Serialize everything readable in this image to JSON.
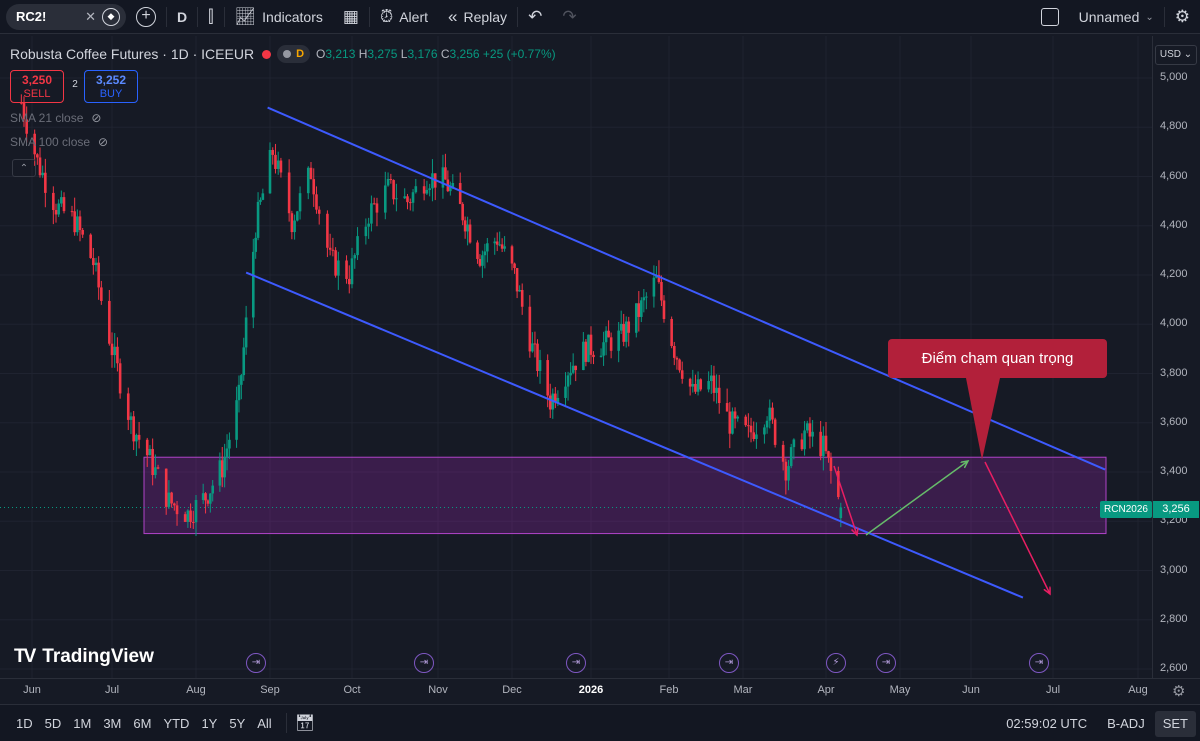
{
  "toolbar": {
    "symbol": "RC2!",
    "interval": "D",
    "indicators_label": "Indicators",
    "alert_label": "Alert",
    "replay_label": "Replay",
    "layout_name": "Unnamed"
  },
  "legend": {
    "title": "Robusta Coffee Futures · 1D · ICEEUR",
    "pill_interval": "D",
    "ohlc": {
      "open": "3,213",
      "high": "3,275",
      "low": "3,176",
      "close": "3,256",
      "change": "+25 (+0.77%)"
    },
    "sell_price": "3,250",
    "sell_label": "SELL",
    "buy_price": "3,252",
    "buy_label": "BUY",
    "spread": "2",
    "indicators": [
      "SMA 21 close",
      "SMA 100 close"
    ]
  },
  "price_axis": {
    "currency": "USD",
    "ticks": [
      "5,000",
      "4,800",
      "4,600",
      "4,400",
      "4,200",
      "4,000",
      "3,800",
      "3,600",
      "3,400",
      "3,200",
      "3,000",
      "2,800",
      "2,600"
    ],
    "last_price": "3,256",
    "contract_label": "RCN2026"
  },
  "time_axis": {
    "ticks": [
      "Jun",
      "Jul",
      "Aug",
      "Sep",
      "Oct",
      "Nov",
      "Dec",
      "2026",
      "Feb",
      "Mar",
      "Apr",
      "May",
      "Jun",
      "Jul",
      "Aug"
    ]
  },
  "annotation": {
    "callout_text": "Điểm chạm quan trọng"
  },
  "watermark": "TradingView",
  "bottom": {
    "ranges": [
      "1D",
      "5D",
      "1M",
      "3M",
      "6M",
      "YTD",
      "1Y",
      "5Y",
      "All"
    ],
    "clock": "02:59:02 UTC",
    "adj": "B-ADJ",
    "set": "SET"
  },
  "colors": {
    "up": "#089981",
    "down": "#f23645",
    "channel": "#2962ff",
    "zone": "#9c27b0",
    "callout": "#b2203a"
  },
  "chart_data": {
    "type": "candlestick",
    "title": "Robusta Coffee Futures · 1D · ICEEUR",
    "ylim": [
      2600,
      5000
    ],
    "x_labels": [
      "Jun",
      "Jul",
      "Aug",
      "Sep",
      "Oct",
      "Nov",
      "Dec",
      "2026",
      "Feb",
      "Mar",
      "Apr",
      "May",
      "Jun",
      "Jul",
      "Aug"
    ],
    "close_path": [
      [
        "2025-05-28",
        4900
      ],
      [
        "2025-06-03",
        4660
      ],
      [
        "2025-06-10",
        4480
      ],
      [
        "2025-06-17",
        4420
      ],
      [
        "2025-06-24",
        4250
      ],
      [
        "2025-07-01",
        3900
      ],
      [
        "2025-07-08",
        3600
      ],
      [
        "2025-07-15",
        3450
      ],
      [
        "2025-07-22",
        3280
      ],
      [
        "2025-07-29",
        3230
      ],
      [
        "2025-08-05",
        3300
      ],
      [
        "2025-08-12",
        3420
      ],
      [
        "2025-08-19",
        3700
      ],
      [
        "2025-08-26",
        4400
      ],
      [
        "2025-09-02",
        4700
      ],
      [
        "2025-09-09",
        4420
      ],
      [
        "2025-09-16",
        4620
      ],
      [
        "2025-09-23",
        4260
      ],
      [
        "2025-09-30",
        4200
      ],
      [
        "2025-10-07",
        4450
      ],
      [
        "2025-10-14",
        4550
      ],
      [
        "2025-10-21",
        4500
      ],
      [
        "2025-10-28",
        4600
      ],
      [
        "2025-11-04",
        4580
      ],
      [
        "2025-11-11",
        4450
      ],
      [
        "2025-11-18",
        4280
      ],
      [
        "2025-11-25",
        4350
      ],
      [
        "2025-12-02",
        4200
      ],
      [
        "2025-12-09",
        3900
      ],
      [
        "2025-12-16",
        3690
      ],
      [
        "2025-12-23",
        3820
      ],
      [
        "2025-12-30",
        3900
      ],
      [
        "2026-01-06",
        3920
      ],
      [
        "2026-01-13",
        3950
      ],
      [
        "2026-01-20",
        4050
      ],
      [
        "2026-01-27",
        4180
      ],
      [
        "2026-02-03",
        3900
      ],
      [
        "2026-02-10",
        3720
      ],
      [
        "2026-02-17",
        3760
      ],
      [
        "2026-02-24",
        3600
      ],
      [
        "2026-03-03",
        3550
      ],
      [
        "2026-03-10",
        3650
      ],
      [
        "2026-03-17",
        3420
      ],
      [
        "2026-03-24",
        3560
      ],
      [
        "2026-03-31",
        3500
      ],
      [
        "2026-04-07",
        3256
      ]
    ],
    "ohlc_last": {
      "open": 3213,
      "high": 3275,
      "low": 3176,
      "close": 3256
    },
    "support_zone": [
      3150,
      3460
    ],
    "channel_upper": [
      [
        "2025-08-31",
        4880
      ],
      [
        "2026-07-20",
        3410
      ]
    ],
    "channel_lower": [
      [
        "2025-08-22",
        4210
      ],
      [
        "2026-06-20",
        2890
      ]
    ]
  }
}
